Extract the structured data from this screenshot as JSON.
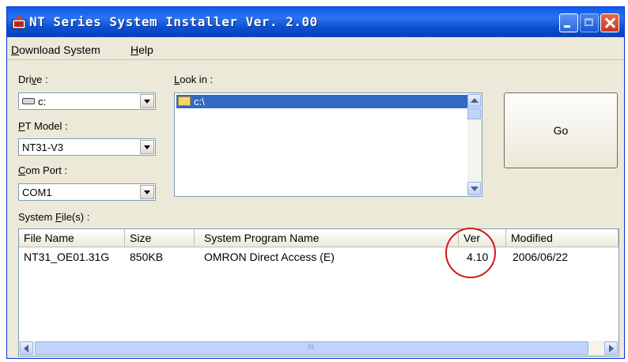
{
  "window": {
    "title": "NT Series System Installer Ver. 2.00"
  },
  "menu": {
    "items": [
      {
        "prefix": "",
        "accel": "D",
        "rest": "ownload System"
      },
      {
        "prefix": "",
        "accel": "H",
        "rest": "elp"
      }
    ]
  },
  "left_panel": {
    "drive": {
      "label_prefix": "Dri",
      "label_accel": "v",
      "label_rest": "e :",
      "value": "c:"
    },
    "pt_model": {
      "label_prefix": "",
      "label_accel": "P",
      "label_rest": "T Model :",
      "value": "NT31-V3"
    },
    "com_port": {
      "label_prefix": "",
      "label_accel": "C",
      "label_rest": "om Port :",
      "value": "COM1"
    }
  },
  "look_in": {
    "label_accel": "L",
    "label_rest": "ook in :",
    "items": [
      "c:\\"
    ]
  },
  "go_button": {
    "label": "Go"
  },
  "system_files": {
    "label_prefix": "System ",
    "label_accel": "F",
    "label_rest": "ile(s) :",
    "columns": [
      "File Name",
      "Size",
      "System Program Name",
      "Ver",
      "Modified"
    ],
    "rows": [
      {
        "file_name": "NT31_OE01.31G",
        "size": "850KB",
        "program": "OMRON Direct Access (E)",
        "ver": "4.10",
        "modified": "2006/06/22"
      }
    ],
    "scroll_grip": "III"
  },
  "colors": {
    "titlebar": "#0a5be8",
    "selection": "#316ac5",
    "annotation_circle": "#d01818"
  }
}
